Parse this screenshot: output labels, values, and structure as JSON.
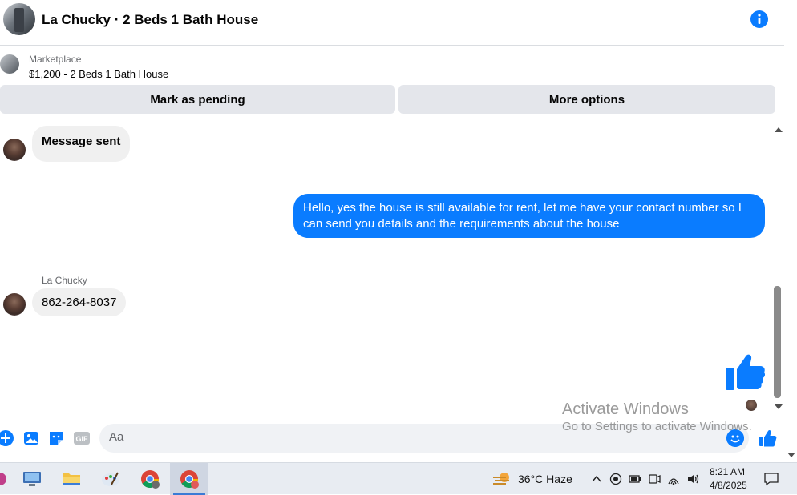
{
  "header": {
    "title": "La Chucky · 2 Beds 1 Bath House",
    "avatar_icon": "house-photo-avatar",
    "info_icon": "info-icon"
  },
  "marketplace": {
    "label": "Marketplace",
    "listing": "$1,200 - 2 Beds 1 Bath House",
    "pending_button": "Mark as pending",
    "options_button": "More options"
  },
  "messages": [
    {
      "direction": "incoming",
      "text": "Message sent"
    },
    {
      "direction": "outgoing",
      "text": "Hello, yes the house is still available for rent, let me have your contact number so I can send you details and the requirements about the house"
    },
    {
      "direction": "incoming",
      "sender": "La Chucky",
      "text": "862-264-8037"
    },
    {
      "direction": "outgoing",
      "sticker": "thumbs-up-icon"
    }
  ],
  "watermark": {
    "line1": "Activate Windows",
    "line2": "Go to Settings to activate Windows."
  },
  "composer": {
    "placeholder": "Aa",
    "icons": [
      "plus-icon",
      "photo-icon",
      "sticker-icon",
      "gif-icon",
      "emoji-icon",
      "like-icon"
    ],
    "gif_label": "GIF"
  },
  "taskbar": {
    "apps": [
      "app-icon",
      "computer-icon",
      "file-explorer-icon",
      "paint-icon",
      "chrome-icon",
      "chrome-profile-icon"
    ],
    "weather": "36°C  Haze",
    "time": "8:21 AM",
    "date": "4/8/2025"
  },
  "colors": {
    "accent": "#0a7cff",
    "incoming_bubble": "#f0f0f0",
    "button_bg": "#e4e6eb"
  }
}
